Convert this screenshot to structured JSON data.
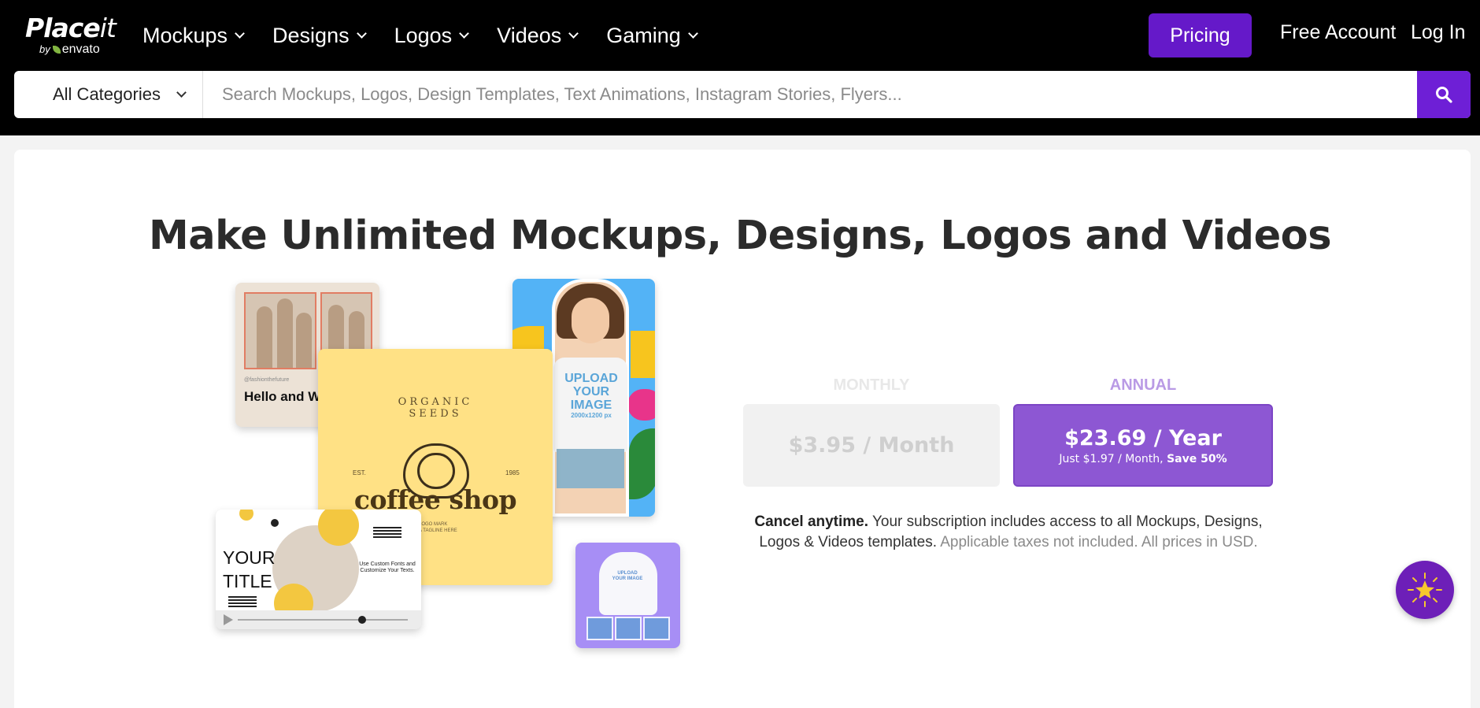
{
  "header": {
    "logo_text_main": "Place",
    "logo_text_italic": "it",
    "logo_by": "by",
    "logo_envato": "envato",
    "nav": [
      {
        "label": "Mockups"
      },
      {
        "label": "Designs"
      },
      {
        "label": "Logos"
      },
      {
        "label": "Videos"
      },
      {
        "label": "Gaming"
      }
    ],
    "pricing_label": "Pricing",
    "free_account_label": "Free Account",
    "login_label": "Log In",
    "brand_color": "#6519c9"
  },
  "search": {
    "category_value": "All Categories",
    "placeholder": "Search Mockups, Logos, Design Templates, Text Animations, Instagram Stories, Flyers...",
    "value": "",
    "button_icon": "search-icon"
  },
  "hero": {
    "headline": "Make Unlimited Mockups, Designs, Logos and Videos",
    "collage": {
      "hello_handle": "@fashionthefuture",
      "hello_title": "Hello and Welcome!",
      "girl_shirt": "UPLOAD YOUR IMAGE",
      "girl_shirt_size": "2000x1200 px",
      "coffee_arc": "ORGANIC SEEDS",
      "coffee_est": "EST.",
      "coffee_year": "1985",
      "coffee_name": "coffee shop",
      "coffee_tagline": "LOGO MARK\nA TAGLINE HERE",
      "video_title": "YOUR TITLE",
      "video_caption": "Use Custom Fonts and Customize Your Texts.",
      "hoodie_text": "UPLOAD YOUR IMAGE"
    }
  },
  "pricing": {
    "monthly_label": "MONTHLY",
    "monthly_price": "$3.95 / Month",
    "annual_label": "ANNUAL",
    "annual_price": "$23.69 / Year",
    "annual_sub_prefix": "Just $1.97 / Month, ",
    "annual_sub_save": "Save 50%",
    "selected": "annual",
    "disclaimer_bold": "Cancel anytime.",
    "disclaimer_text": " Your subscription includes access to all Mockups, Designs, Logos & Videos templates. ",
    "disclaimer_muted": "Applicable taxes not included. All prices in USD."
  },
  "assistant": {
    "icon": "sparkle-star-icon"
  }
}
